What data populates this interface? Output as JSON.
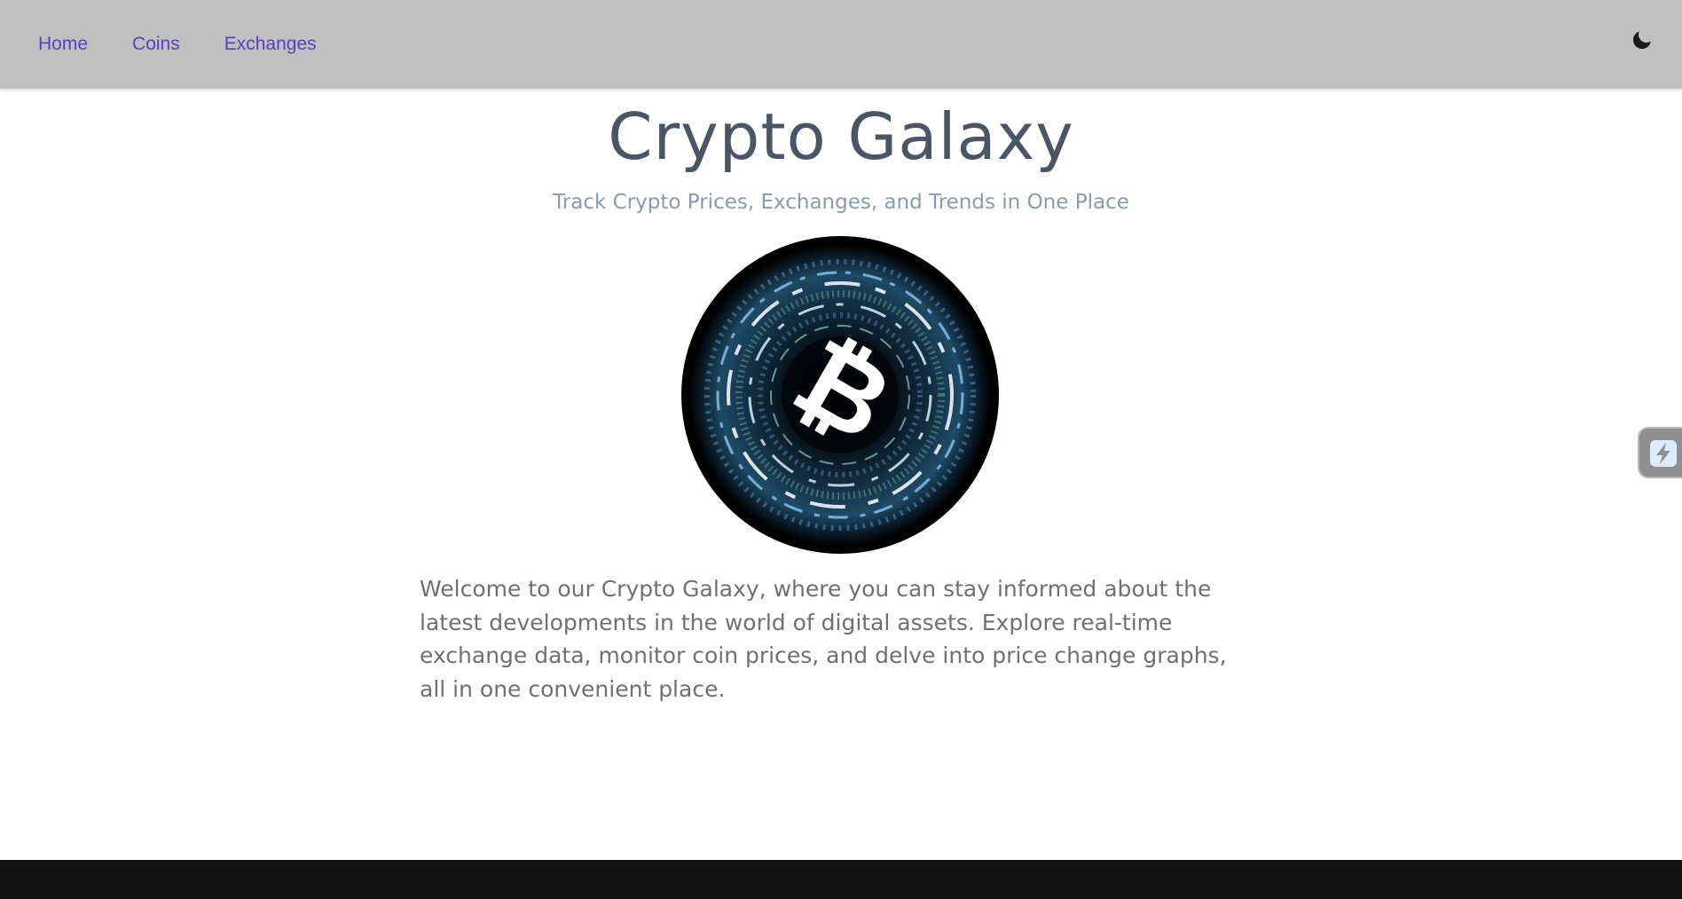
{
  "nav": {
    "links": [
      "Home",
      "Coins",
      "Exchanges"
    ]
  },
  "theme_toggle": {
    "icon": "moon-icon"
  },
  "hero": {
    "title": "Crypto Galaxy",
    "subtitle": "Track Crypto Prices, Exchanges, and Trends in One Place",
    "image_icon": "bitcoin-icon",
    "welcome": "Welcome to our Crypto Galaxy, where you can stay informed about the latest developments in the world of digital assets. Explore real-time exchange data, monitor coin prices, and delve into price change graphs, all in one convenient place."
  },
  "side_handle": {
    "icon": "lightning-icon"
  },
  "colors": {
    "navbar_bg": "#c0c0c0",
    "nav_link": "#5b3cc4",
    "title": "#4a5568",
    "subtitle": "#8a9ab0",
    "body_text": "#707070",
    "footer_bg": "#141414"
  }
}
